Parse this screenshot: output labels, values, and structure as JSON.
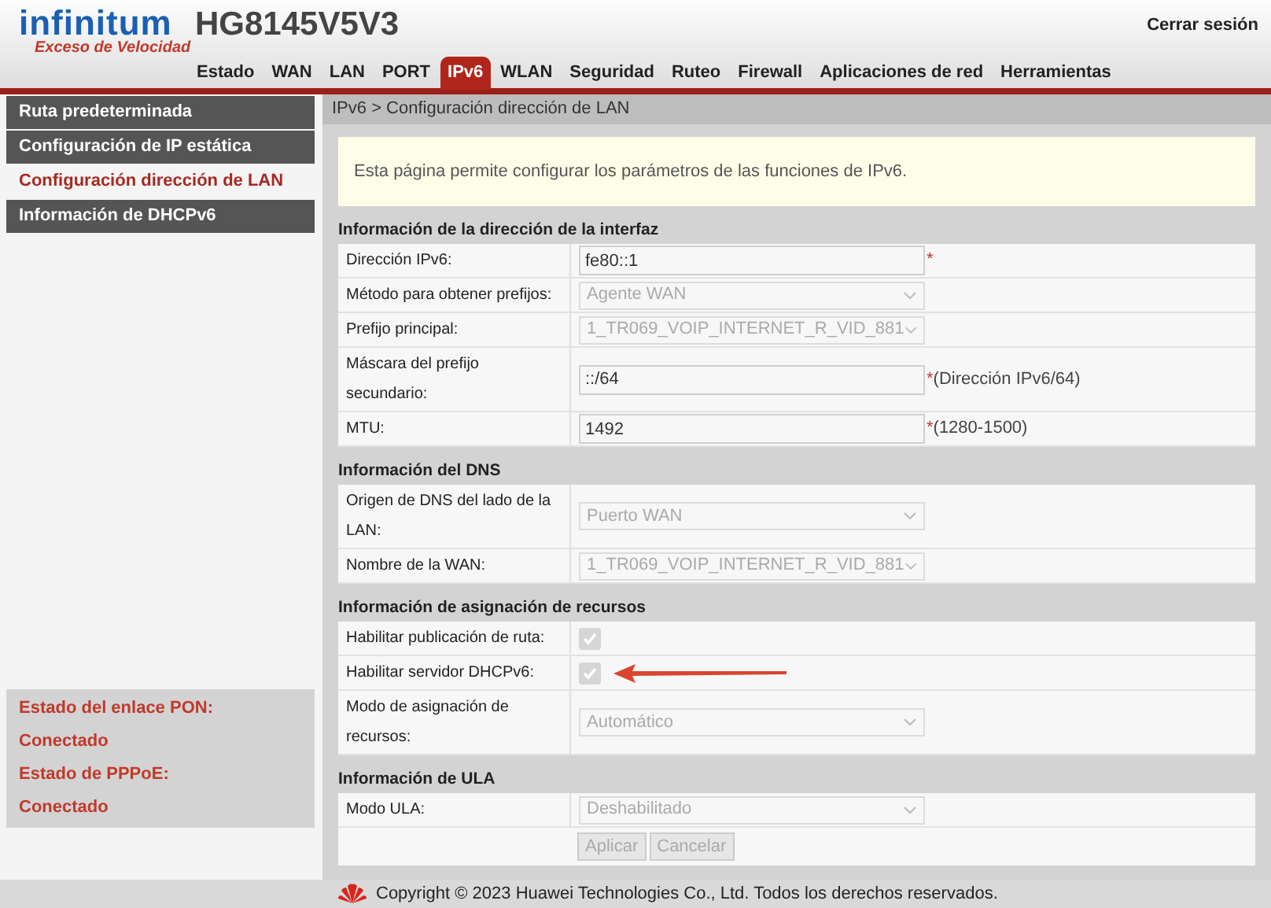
{
  "header": {
    "logo": "infinitum",
    "slogan": "Exceso de Velocidad",
    "model": "HG8145V5V3",
    "logout": "Cerrar sesión"
  },
  "tabs": [
    {
      "label": "Estado",
      "selected": false
    },
    {
      "label": "WAN",
      "selected": false
    },
    {
      "label": "LAN",
      "selected": false
    },
    {
      "label": "PORT",
      "selected": false
    },
    {
      "label": "IPv6",
      "selected": true
    },
    {
      "label": "WLAN",
      "selected": false
    },
    {
      "label": "Seguridad",
      "selected": false
    },
    {
      "label": "Ruteo",
      "selected": false
    },
    {
      "label": "Firewall",
      "selected": false
    },
    {
      "label": "Aplicaciones de red",
      "selected": false
    },
    {
      "label": "Herramientas",
      "selected": false
    }
  ],
  "sidebar": {
    "items": [
      {
        "label": "Ruta predeterminada",
        "selected": false
      },
      {
        "label": "Configuración de IP estática",
        "selected": false
      },
      {
        "label": "Configuración dirección de LAN",
        "selected": true
      },
      {
        "label": "Información de DHCPv6",
        "selected": false
      }
    ],
    "status": [
      "Estado del enlace PON:",
      "Conectado",
      "Estado de PPPoE:",
      "Conectado"
    ]
  },
  "breadcrumb": "IPv6 > Configuración dirección de LAN",
  "notice": "Esta página permite configurar los parámetros de las funciones de IPv6.",
  "sections": [
    {
      "title": "Información de la dirección de la interfaz",
      "rows": [
        {
          "kind": "input",
          "label": "Dirección IPv6:",
          "value": "fe80::1",
          "mark": "*"
        },
        {
          "kind": "select",
          "label": "Método para obtener prefijos:",
          "value": "Agente WAN"
        },
        {
          "kind": "select",
          "label": "Prefijo principal:",
          "value": "1_TR069_VOIP_INTERNET_R_VID_881"
        },
        {
          "kind": "input",
          "label": "Máscara del prefijo secundario:",
          "value": "::/64",
          "mark": "*",
          "hint": "(Dirección IPv6/64)"
        },
        {
          "kind": "input",
          "label": "MTU:",
          "value": "1492",
          "mark": "*",
          "hint": "(1280-1500)"
        }
      ]
    },
    {
      "title": "Información del DNS",
      "rows": [
        {
          "kind": "select",
          "label": "Origen de DNS del lado de la LAN:",
          "value": "Puerto WAN"
        },
        {
          "kind": "select",
          "label": "Nombre de la WAN:",
          "value": "1_TR069_VOIP_INTERNET_R_VID_881"
        }
      ]
    },
    {
      "title": "Información de asignación de recursos",
      "rows": [
        {
          "kind": "checkbox",
          "label": "Habilitar publicación de ruta:",
          "checked": true
        },
        {
          "kind": "checkbox",
          "label": "Habilitar servidor DHCPv6:",
          "checked": true,
          "annotated": true
        },
        {
          "kind": "select",
          "label": "Modo de asignación de recursos:",
          "value": "Automático"
        }
      ]
    },
    {
      "title": "Información de ULA",
      "rows": [
        {
          "kind": "select",
          "label": "Modo ULA:",
          "value": "Deshabilitado"
        }
      ]
    }
  ],
  "buttons": [
    "Aplicar",
    "Cancelar"
  ],
  "footer": "Copyright © 2023 Huawei Technologies Co., Ltd. Todos los derechos reservados."
}
